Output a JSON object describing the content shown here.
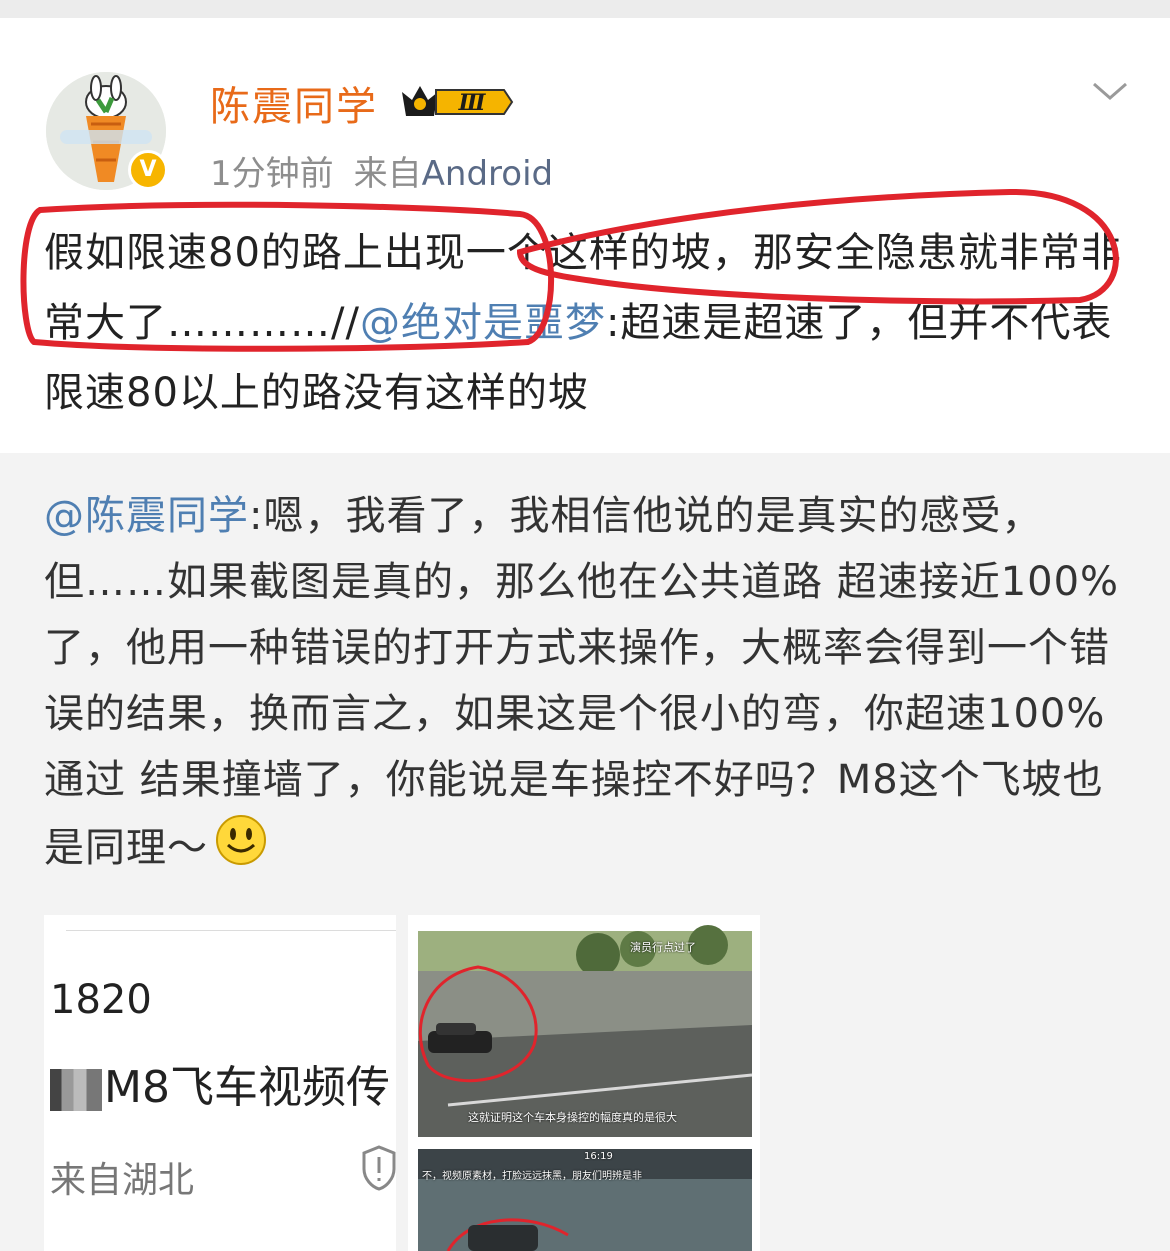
{
  "post": {
    "username": "陈震同学",
    "level_badge": "Ⅲ",
    "verified_mark": "V",
    "time": "1分钟前",
    "source_prefix": "来自",
    "source": "Android",
    "text_1": "假如限速80的路上出现一个这样的坡，那安全隐患就非常非常大了…………//",
    "mention": "@绝对是噩梦",
    "text_2": ":超速是超速了，但并不代表限速80以上的路没有这样的坡"
  },
  "repost": {
    "mention": "@陈震同学",
    "text": ":嗯，我看了，我相信他说的是真实的感受，但……如果截图是真的，那么他在公共道路 超速接近100%了，他用一种错误的打开方式来操作，大概率会得到一个错误的结果，换而言之，如果这是个很小的弯，你超速100%通过 结果撞墙了，你能说是车操控不好吗？M8这个飞坡也是同理～"
  },
  "card": {
    "number": "1820",
    "headline": "M8飞车视频传",
    "location": "来自湖北"
  },
  "video": {
    "caption_top": "演员行点过了",
    "caption_bottom": "这就证明这个车本身操控的幅度真的是很大",
    "caption_2": "不，视频原素材，打脸远远抹黑，朋友们明辨是非",
    "time_2": "16:19"
  },
  "colors": {
    "username": "#e86a19",
    "mention": "#4f7fb2",
    "highlight_circle": "#e0242c",
    "verified": "#f7b500"
  },
  "icons": [
    "chevron-down-icon",
    "crown-level-badge-icon",
    "verified-icon",
    "smiley-emoji-icon",
    "shield-icon"
  ]
}
